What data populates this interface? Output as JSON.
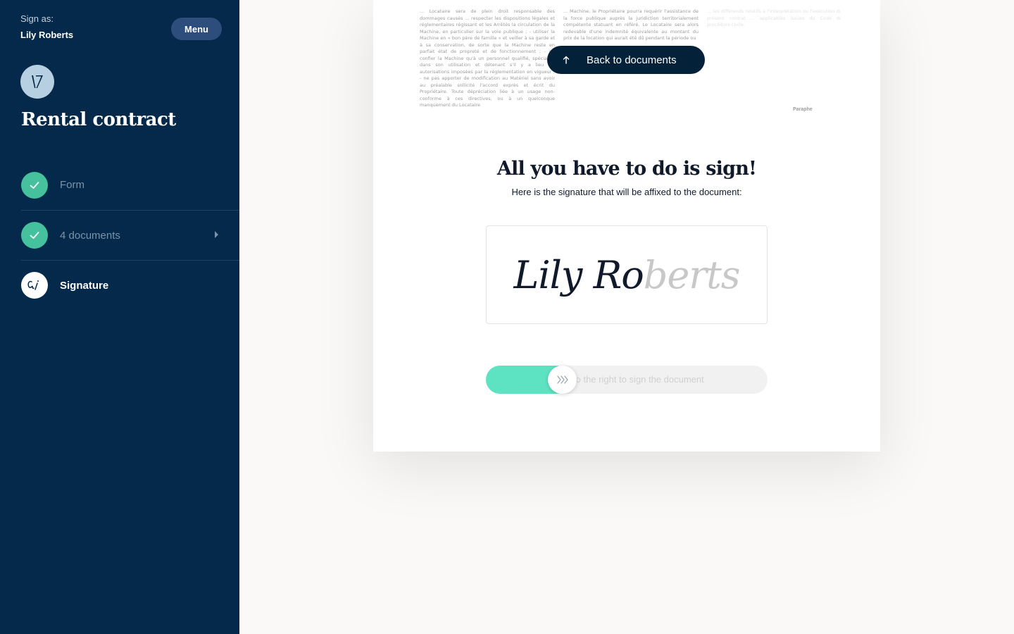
{
  "sidebar": {
    "sign_as_label": "Sign as:",
    "sign_as_name": "Lily Roberts",
    "menu_label": "Menu",
    "document_title": "Rental contract",
    "steps": [
      {
        "label": "Form",
        "status": "completed",
        "icon": "check-icon"
      },
      {
        "label": "4 documents",
        "status": "completed",
        "icon": "check-icon"
      },
      {
        "label": "Signature",
        "status": "active",
        "icon": "signature-icon"
      }
    ]
  },
  "document": {
    "preview_col1": "... Locataire sera de plein droit responsable des dommages causés ... respecter les dispositions légales et réglementaires régissant et les Arrêtés la circulation de la Machine, en particulier sur la voie publique ; - utiliser la Machine en « bon père de famille » et veiller à sa garde et à sa conservation, de sorte que la Machine reste en parfait état de propreté et de fonctionnement ; - ne confier la Machine qu'à un personnel qualifié, spécialisé dans son utilisation et détenant s'il y a lieu les autorisations imposées par la réglementation en vigueur ; - ne pas apporter de modification au Matériel sans avoir au préalable sollicité l'accord exprès et écrit du Propriétaire. Toute dépréciation liée à un usage non-conforme à ces directives, ou à un quelconque manquement du Locataire",
    "preview_col2": "... Machine, le Propriétaire pourra requérir l'assistance de la force publique auprès la juridiction territorialement compétente statuant en référé. Le Locataire sera alors redevable d'une indemnité équivalente au montant du prix de la location qui aurait été dû pendant la période ou",
    "preview_col3": "... les différends relatifs à l'interprétation ou l'exécution du présent contrat ... applicables issues du Code de procédure civile.",
    "paraphe": "Paraphe",
    "back_button": "Back to documents",
    "headline": "All you have to do is sign!",
    "subline": "Here is the signature that will be affixed to the document:",
    "signature_name": "Lily Roberts",
    "signature_dark_part": "Lily Ro",
    "signature_light_part": "berts",
    "slider_text": "to the right to sign the document",
    "slider_progress": 0.27
  },
  "colors": {
    "sidebar_bg": "#04294a",
    "accent_green": "#46c19e",
    "slider_fill": "#5de3c1",
    "dark_text": "#111a2b"
  }
}
